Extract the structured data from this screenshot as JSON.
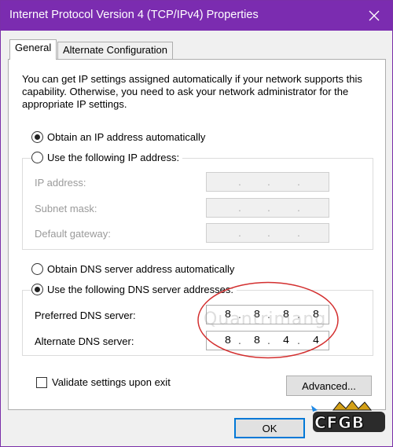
{
  "window": {
    "title": "Internet Protocol Version 4 (TCP/IPv4) Properties",
    "close_icon": "close-icon",
    "titlebar_color": "#7b2cb0"
  },
  "tabs": [
    {
      "label": "General",
      "active": true
    },
    {
      "label": "Alternate Configuration",
      "active": false
    }
  ],
  "intro_text": "You can get IP settings assigned automatically if your network supports this capability. Otherwise, you need to ask your network administrator for the appropriate IP settings.",
  "ip": {
    "auto_label": "Obtain an IP address automatically",
    "auto_selected": true,
    "manual_label": "Use the following IP address:",
    "manual_selected": false,
    "fields": [
      {
        "label": "IP address:",
        "value": "",
        "enabled": false
      },
      {
        "label": "Subnet mask:",
        "value": "",
        "enabled": false
      },
      {
        "label": "Default gateway:",
        "value": "",
        "enabled": false
      }
    ]
  },
  "dns": {
    "auto_label": "Obtain DNS server address automatically",
    "auto_selected": false,
    "manual_label": "Use the following DNS server addresses:",
    "manual_selected": true,
    "preferred": {
      "label": "Preferred DNS server:",
      "octets": [
        "8",
        "8",
        "8",
        "8"
      ]
    },
    "alternate": {
      "label": "Alternate DNS server:",
      "octets": [
        "8",
        "8",
        "4",
        "4"
      ]
    },
    "highlight_color": "#d32f2f"
  },
  "validate": {
    "label": "Validate settings upon exit",
    "checked": false
  },
  "buttons": {
    "advanced": "Advanced...",
    "ok": "OK"
  },
  "watermark_text": "Quantrimang",
  "logo": {
    "brand": "CFGB",
    "icon": "cfgb-logo-icon"
  }
}
